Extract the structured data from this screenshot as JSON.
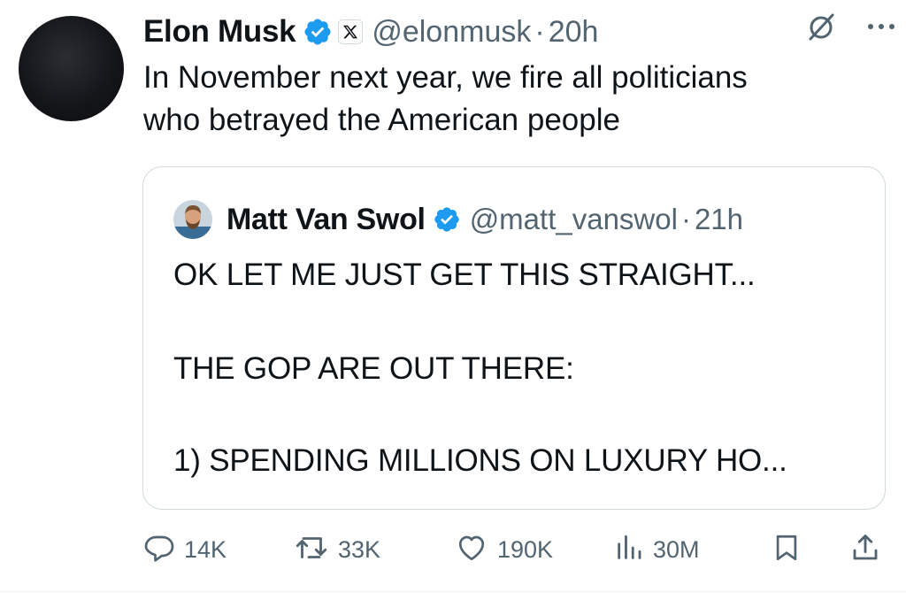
{
  "tweet": {
    "author_name": "Elon Musk",
    "handle": "@elonmusk",
    "separator": "·",
    "time": "20h",
    "text_line1": "In November next year, we fire all politicians",
    "text_line2": "who betrayed the American people"
  },
  "quote": {
    "author_name": "Matt Van Swol",
    "handle": "@matt_vanswol",
    "separator": "·",
    "time": "21h",
    "line1": "OK LET ME JUST GET THIS STRAIGHT...",
    "line2": "THE GOP ARE OUT THERE:",
    "line3": "1) SPENDING MILLIONS ON LUXURY HO..."
  },
  "actions": {
    "replies": "14K",
    "reposts": "33K",
    "likes": "190K",
    "views": "30M"
  },
  "colors": {
    "verified": "#1d9bf0",
    "secondary_text": "#536471",
    "border": "#cfd9de",
    "primary_text": "#0f1419"
  },
  "icons": [
    "verified-badge-icon",
    "x-logo-icon",
    "grok-icon",
    "more-icon",
    "reply-icon",
    "repost-icon",
    "like-icon",
    "views-icon",
    "bookmark-icon",
    "share-icon"
  ]
}
